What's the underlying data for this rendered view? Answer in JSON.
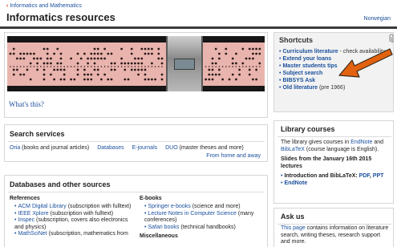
{
  "breadcrumb": "Informatics and Mathematics",
  "page_title": "Informatics resources",
  "language_link": "Norwegian",
  "hero": {
    "link": "What's this?"
  },
  "shortcuts": {
    "title": "Shortcuts",
    "items": [
      {
        "label": "Curriculum literature",
        "suffix": " - check availability"
      },
      {
        "label": "Extend your loans",
        "suffix": ""
      },
      {
        "label": "Master students tips",
        "suffix": ""
      },
      {
        "label": "Subject search",
        "suffix": ""
      },
      {
        "label": "BIBSYS Ask",
        "suffix": ""
      },
      {
        "label": "Old literature",
        "suffix": " (pre 1966)"
      }
    ]
  },
  "search_services": {
    "title": "Search services",
    "oria": "Oria",
    "oria_note": " (books and journal articles)",
    "databases": "Databases",
    "ejournals": "E-journals",
    "duo": "DUO",
    "duo_note": " (master theses and more)",
    "from_home": "From home and away"
  },
  "databases": {
    "title": "Databases and other sources",
    "references_heading": "References",
    "references": [
      {
        "label": "ACM Digital Library",
        "note": " (subscription with fulltext)"
      },
      {
        "label": "IEEE Xplore",
        "note": " (subscription with fulltext)"
      },
      {
        "label": "Inspec",
        "note": " (subscription, covers also electronics and physics)"
      },
      {
        "label": "MathSciNet",
        "note": " (subscription, mathematics from"
      }
    ],
    "ebooks_heading": "E-books",
    "ebooks": [
      {
        "label": "Springer e-books",
        "note": " (science and more)"
      },
      {
        "label": "Lecture Notes in Computer Science",
        "note": " (many conferences)"
      },
      {
        "label": "Safari books",
        "note": " (technical handbooks)"
      }
    ],
    "misc_heading": "Miscellaneous"
  },
  "library_courses": {
    "title": "Library courses",
    "intro_1": "The library gives courses in ",
    "intro_endnote": "EndNote",
    "intro_and": " and ",
    "intro_bibtex": "BibLaTeX",
    "intro_2": " (course language is English).",
    "slides_heading": "Slides from the January 16th 2015 lectures",
    "slide_1_text": "Introduction and BibLaTeX: ",
    "slide_1_pdf": "PDF",
    "slide_1_sep": ", ",
    "slide_1_ppt": "PPT",
    "slide_2": "EndNote"
  },
  "ask_us": {
    "title": "Ask us",
    "text_link": "This page",
    "text": " contains information on literature search, writing theses, research support and more."
  },
  "colors": {
    "link": "#1a4f9c",
    "arrow": "#e2620f",
    "breadcrumb_arrow": "#c0392b"
  },
  "icons": [
    "breadcrumb-back-icon",
    "pointer-arrow-icon",
    "paperclip-icon"
  ]
}
